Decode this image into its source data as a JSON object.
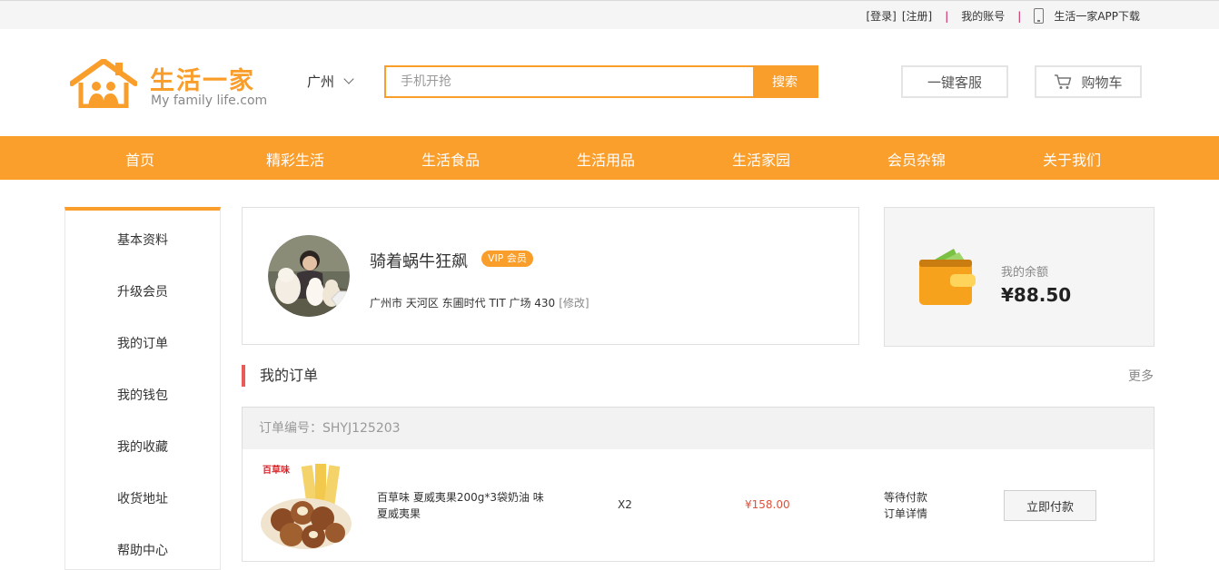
{
  "topbar": {
    "login": "[登录]",
    "register": "[注册]",
    "account": "我的账号",
    "app_download": "生活一家APP下载"
  },
  "logo": {
    "cn": "生活一家",
    "en": "My family life.com"
  },
  "city": "广州",
  "search": {
    "placeholder": "手机开抢",
    "button": "搜索"
  },
  "header_buttons": {
    "service": "一键客服",
    "cart": "购物车"
  },
  "nav": [
    "首页",
    "精彩生活",
    "生活食品",
    "生活用品",
    "生活家园",
    "会员杂锦",
    "关于我们"
  ],
  "sidebar": [
    "基本资料",
    "升级会员",
    "我的订单",
    "我的钱包",
    "我的收藏",
    "收货地址",
    "帮助中心"
  ],
  "profile": {
    "username": "骑着蜗牛狂飙",
    "badge": "VIP 会员",
    "address": "广州市 天河区 东圃时代 TIT 广场 430",
    "edit": "[修改]"
  },
  "balance": {
    "label": "我的余额",
    "value": "¥88.50"
  },
  "orders": {
    "title": "我的订单",
    "more": "更多",
    "order_no_label": "订单编号：",
    "order_no": "SHYJ125203",
    "item": {
      "brand": "百草味",
      "name": "百草味 夏威夷果200g*3袋奶油 味 夏威夷果",
      "qty": "X2",
      "price": "¥158.00",
      "status": "等待付款",
      "detail": "订单详情",
      "action": "立即付款"
    }
  },
  "colors": {
    "accent": "#f99d2b",
    "price": "#e0503a",
    "section_marker": "#e95b57"
  }
}
